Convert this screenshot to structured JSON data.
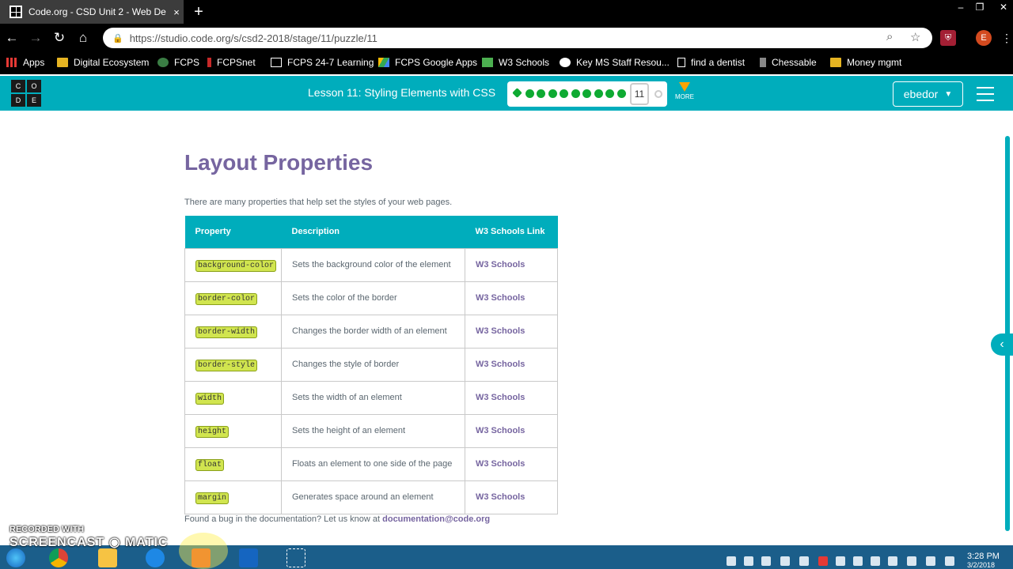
{
  "browser": {
    "tab_title": "Code.org - CSD Unit 2 - Web De",
    "tab_close": "×",
    "new_tab": "+",
    "url": "https://studio.code.org/s/csd2-2018/stage/11/puzzle/11",
    "profile_initial": "E",
    "window_controls": [
      "–",
      "❐",
      "✕"
    ]
  },
  "bookmarks": [
    {
      "label": "Apps",
      "icon": "apps-grid-icon"
    },
    {
      "label": "Digital Ecosystem",
      "icon": "folder-icon"
    },
    {
      "label": "FCPS",
      "icon": "fcps-icon"
    },
    {
      "label": "FCPSnet",
      "icon": "fcpsnet-icon"
    },
    {
      "label": "FCPS 24-7 Learning",
      "icon": "bb-icon"
    },
    {
      "label": "FCPS Google Apps",
      "icon": "drive-icon"
    },
    {
      "label": "W3 Schools",
      "icon": "w3-icon"
    },
    {
      "label": "Key MS Staff Resou...",
      "icon": "google-icon"
    },
    {
      "label": "find a dentist",
      "icon": "page-icon"
    },
    {
      "label": "Chessable",
      "icon": "chess-icon"
    },
    {
      "label": "Money mgmt",
      "icon": "folder-icon"
    }
  ],
  "header": {
    "logo": [
      "C",
      "O",
      "D",
      "E"
    ],
    "lesson": "Lesson 11: Styling Elements with CSS",
    "current_level": "11",
    "more": "MORE",
    "user": "ebedor",
    "completed_levels": 10
  },
  "content": {
    "heading": "Layout Properties",
    "intro": "There are many properties that help set the styles of your web pages.",
    "columns": [
      "Property",
      "Description",
      "W3 Schools Link"
    ],
    "rows": [
      {
        "property": "background-color",
        "description": "Sets the background color of the element",
        "link": "W3 Schools"
      },
      {
        "property": "border-color",
        "description": "Sets the color of the border",
        "link": "W3 Schools"
      },
      {
        "property": "border-width",
        "description": "Changes the border width of an element",
        "link": "W3 Schools"
      },
      {
        "property": "border-style",
        "description": "Changes the style of border",
        "link": "W3 Schools"
      },
      {
        "property": "width",
        "description": "Sets the width of an element",
        "link": "W3 Schools"
      },
      {
        "property": "height",
        "description": "Sets the height of an element",
        "link": "W3 Schools"
      },
      {
        "property": "float",
        "description": "Floats an element to one side of the page",
        "link": "W3 Schools"
      },
      {
        "property": "margin",
        "description": "Generates space around an element",
        "link": "W3 Schools"
      }
    ],
    "footnote_text": "Found a bug in the documentation? Let us know at ",
    "footnote_email": "documentation@code.org"
  },
  "taskbar": {
    "time": "3:28 PM",
    "date": "3/2/2018"
  },
  "watermark": {
    "line1": "RECORDED WITH",
    "line2": "SCREENCAST ◉ MATIC"
  },
  "colors": {
    "teal": "#00adbc",
    "purple": "#7665a0",
    "green": "#0eaa32",
    "highlight": "#d1e54f"
  }
}
